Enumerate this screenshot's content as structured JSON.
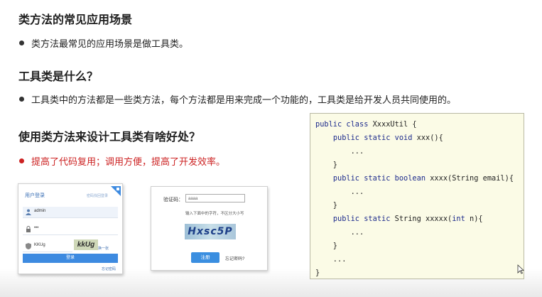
{
  "section1": {
    "heading": "类方法的常见应用场景",
    "bullet": "类方法最常见的应用场景是做工具类。"
  },
  "section2": {
    "heading": "工具类是什么？",
    "bullet": "工具类中的方法都是一些类方法，每个方法都是用来完成一个功能的，工具类是给开发人员共同使用的。"
  },
  "section3": {
    "heading": "使用类方法来设计工具类有啥好处？",
    "bullet": "提高了代码复用；调用方便，提高了开发效率。",
    "accent_color": "#cc2222"
  },
  "code": {
    "lines": [
      "public class XxxxUtil {",
      "    public static void xxx(){",
      "        ...",
      "    }",
      "    public static boolean xxxx(String email){",
      "        ...",
      "    }",
      "    public static String xxxxx(int n){",
      "        ...",
      "    }",
      "    ...",
      "}"
    ]
  },
  "login_card": {
    "title": "用户登录",
    "top_link": "密码找回登录",
    "username": "admin",
    "password": "•••",
    "captcha_input": "KKUg",
    "captcha_image": "kkUg",
    "refresh": "换一张",
    "button": "登录",
    "forgot": "忘记密码"
  },
  "captcha_card": {
    "label": "验证码：",
    "input_value": "aaaa",
    "hint": "输入下面中的字符，不区分大小写",
    "image_text": "Hxsc5P",
    "button": "注册",
    "forgot": "忘记密码?"
  }
}
